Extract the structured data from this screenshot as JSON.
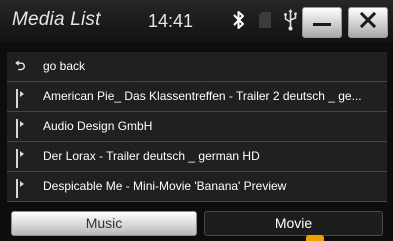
{
  "header": {
    "title": "Media List",
    "clock": "14:41",
    "status_icons": [
      "bluetooth-icon",
      "sd-card-icon",
      "usb-icon"
    ],
    "minimize_icon": "minimize-icon",
    "close_icon": "close-icon"
  },
  "list": {
    "items": [
      {
        "label": "go back",
        "icon": "back-arrow-icon"
      },
      {
        "label": "American Pie_ Das Klassentreffen - Trailer 2 deutsch _ ge...",
        "icon": "video-file-icon"
      },
      {
        "label": "Audio Design GmbH",
        "icon": "video-file-icon"
      },
      {
        "label": "Der Lorax - Trailer deutsch _ german HD",
        "icon": "video-file-icon"
      },
      {
        "label": "Despicable Me - Mini-Movie 'Banana' Preview",
        "icon": "video-file-icon"
      }
    ]
  },
  "tabs": {
    "music_label": "Music",
    "movie_label": "Movie",
    "selected": "Movie",
    "accent_color": "#f0a000"
  }
}
